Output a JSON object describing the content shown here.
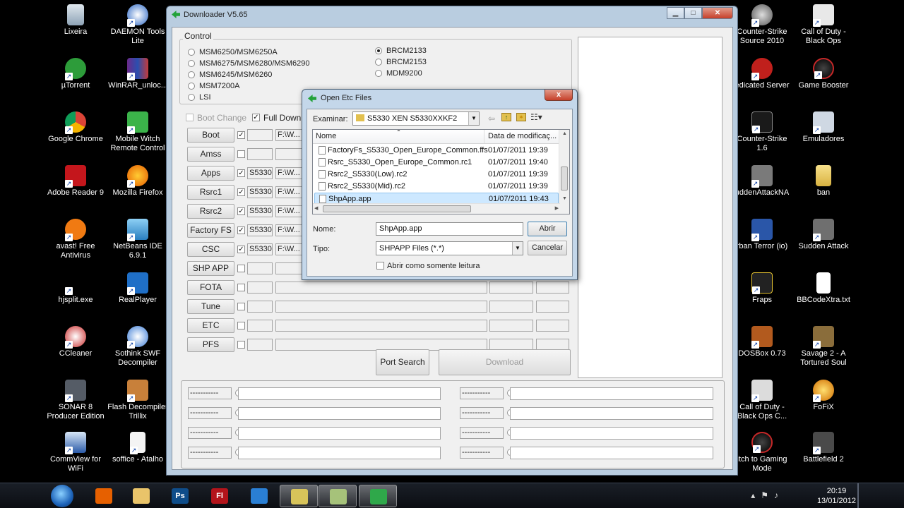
{
  "desktop": {
    "left_icons": [
      {
        "label": "Lixeira"
      },
      {
        "label": "DAEMON Tools Lite"
      },
      {
        "label": "µTorrent"
      },
      {
        "label": "WinRAR_unloc..."
      },
      {
        "label": "Google Chrome"
      },
      {
        "label": "Mobile Witch Remote Control"
      },
      {
        "label": "Adobe Reader 9"
      },
      {
        "label": "Mozilla Firefox"
      },
      {
        "label": "avast! Free Antivirus"
      },
      {
        "label": "NetBeans IDE 6.9.1"
      },
      {
        "label": "hjsplit.exe"
      },
      {
        "label": "RealPlayer"
      },
      {
        "label": "CCleaner"
      },
      {
        "label": "Sothink SWF Decompiler"
      },
      {
        "label": "SONAR 8 Producer Edition"
      },
      {
        "label": "Flash Decompiler Trillix"
      },
      {
        "label": "CommView for WiFi"
      },
      {
        "label": "soffice - Atalho"
      }
    ],
    "right_icons": [
      {
        "label": "Counter-Strike Source 2010"
      },
      {
        "label": "Call of Duty - Black Ops"
      },
      {
        "label": "edicated Server"
      },
      {
        "label": "Game Booster"
      },
      {
        "label": "Counter-Strike 1.6"
      },
      {
        "label": "Emuladores"
      },
      {
        "label": "uddenAttackNA"
      },
      {
        "label": "ban"
      },
      {
        "label": "rban Terror (io)"
      },
      {
        "label": "Sudden Attack"
      },
      {
        "label": "Fraps"
      },
      {
        "label": "BBCodeXtra.txt"
      },
      {
        "label": "DOSBox 0.73"
      },
      {
        "label": "Savage 2 - A Tortured Soul"
      },
      {
        "label": "Call of Duty - Black Ops C..."
      },
      {
        "label": "FoFiX"
      },
      {
        "label": "itch to Gaming Mode"
      },
      {
        "label": "Battlefield 2"
      }
    ]
  },
  "downloader": {
    "title": "Downloader V5.65",
    "control_label": "Control",
    "chipsets_left": [
      "MSM6250/MSM6250A",
      "MSM6275/MSM6280/MSM6290",
      "MSM6245/MSM6260",
      "MSM7200A",
      "LSI"
    ],
    "chipsets_right": [
      "BRCM2133",
      "BRCM2153",
      "MDM9200"
    ],
    "selected_chipset": "BRCM2133",
    "boot_change_label": "Boot Change",
    "full_download_label": "Full Downl",
    "rows": [
      {
        "button": "Boot",
        "checked": true,
        "name": "",
        "path": "F:\\W..."
      },
      {
        "button": "Amss",
        "checked": false,
        "name": "",
        "path": ""
      },
      {
        "button": "Apps",
        "checked": true,
        "name": "S5330",
        "path": "F:\\W..."
      },
      {
        "button": "Rsrc1",
        "checked": true,
        "name": "S5330",
        "path": "F:\\W..."
      },
      {
        "button": "Rsrc2",
        "checked": true,
        "name": "S5330",
        "path": "F:\\W..."
      },
      {
        "button": "Factory FS",
        "checked": true,
        "name": "S5330",
        "path": "F:\\W..."
      },
      {
        "button": "CSC",
        "checked": true,
        "name": "S5330",
        "path": "F:\\W..."
      },
      {
        "button": "SHP APP",
        "checked": false,
        "name": "",
        "path": ""
      },
      {
        "button": "FOTA",
        "checked": false,
        "name": "",
        "path": ""
      },
      {
        "button": "Tune",
        "checked": false,
        "name": "",
        "path": ""
      },
      {
        "button": "ETC",
        "checked": false,
        "name": "",
        "path": ""
      },
      {
        "button": "PFS",
        "checked": false,
        "name": "",
        "path": ""
      }
    ],
    "port_search_label": "Port Search",
    "download_label": "Download",
    "port_placeholder": "-----------"
  },
  "dialog": {
    "title": "Open Etc Files",
    "close_glyph": "x",
    "look_in_label": "Examinar:",
    "look_in_value": "S5330 XEN S5330XXKF2",
    "col_name": "Nome",
    "col_date": "Data de modificaç...",
    "files": [
      {
        "name": "FactoryFs_S5330_Open_Europe_Common.ffs",
        "date": "01/07/2011 19:39",
        "selected": false
      },
      {
        "name": "Rsrc_S5330_Open_Europe_Common.rc1",
        "date": "01/07/2011 19:40",
        "selected": false
      },
      {
        "name": "Rsrc2_S5330(Low).rc2",
        "date": "01/07/2011 19:39",
        "selected": false
      },
      {
        "name": "Rsrc2_S5330(Mid).rc2",
        "date": "01/07/2011 19:39",
        "selected": false
      },
      {
        "name": "ShpApp.app",
        "date": "01/07/2011 19:43",
        "selected": true
      }
    ],
    "filename_label": "Nome:",
    "filename_value": "ShpApp.app",
    "filetype_label": "Tipo:",
    "filetype_value": "SHPAPP Files (*.*)",
    "open_label": "Abrir",
    "cancel_label": "Cancelar",
    "readonly_label": "Abrir como somente leitura"
  },
  "taskbar": {
    "apps": [
      {
        "icon": "firefox-icon",
        "text": "",
        "color": "#e66000"
      },
      {
        "icon": "explorer-icon",
        "text": "",
        "color": "#e9c46a"
      },
      {
        "icon": "photoshop-icon",
        "text": "Ps",
        "color": "#0f4d8a"
      },
      {
        "icon": "flash-icon",
        "text": "Fl",
        "color": "#b3141b"
      },
      {
        "icon": "ie-icon",
        "text": "",
        "color": "#2a7fd4"
      },
      {
        "icon": "folder-icon",
        "text": "",
        "color": "#d8c45a"
      },
      {
        "icon": "notes-icon",
        "text": "",
        "color": "#a6c27a"
      },
      {
        "icon": "downloader-icon",
        "text": "",
        "color": "#2fa84a"
      }
    ],
    "time": "20:19",
    "date": "13/01/2012"
  }
}
